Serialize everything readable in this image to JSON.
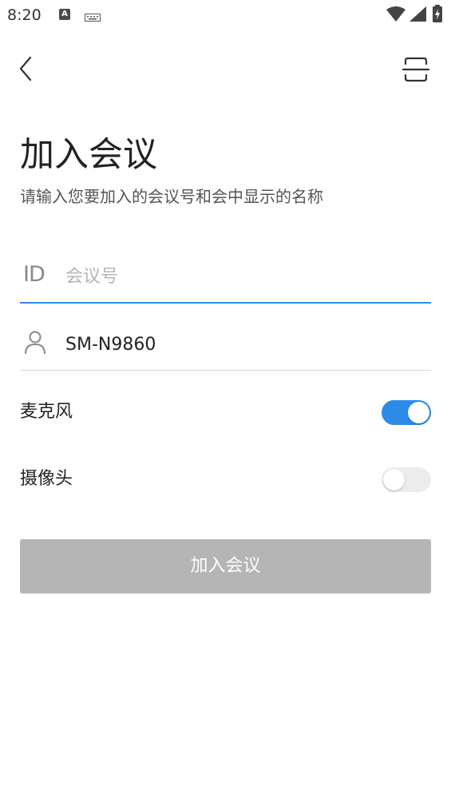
{
  "status_bar": {
    "time": "8:20",
    "notification_icon": "A"
  },
  "header": {
    "back_icon": "chevron-left-icon",
    "scan_icon": "scan-icon"
  },
  "title": "加入会议",
  "subtitle": "请输入您要加入的会议号和会中显示的名称",
  "meeting_id_field": {
    "icon_label": "ID",
    "value": "",
    "placeholder": "会议号"
  },
  "name_field": {
    "icon": "user-icon",
    "value": "SM-N9860"
  },
  "toggles": {
    "microphone": {
      "label": "麦克风",
      "on": true
    },
    "camera": {
      "label": "摄像头",
      "on": false
    }
  },
  "join_button": {
    "label": "加入会议",
    "enabled": false
  },
  "colors": {
    "accent": "#2b8be6",
    "disabled_button": "#b5b5b5"
  }
}
